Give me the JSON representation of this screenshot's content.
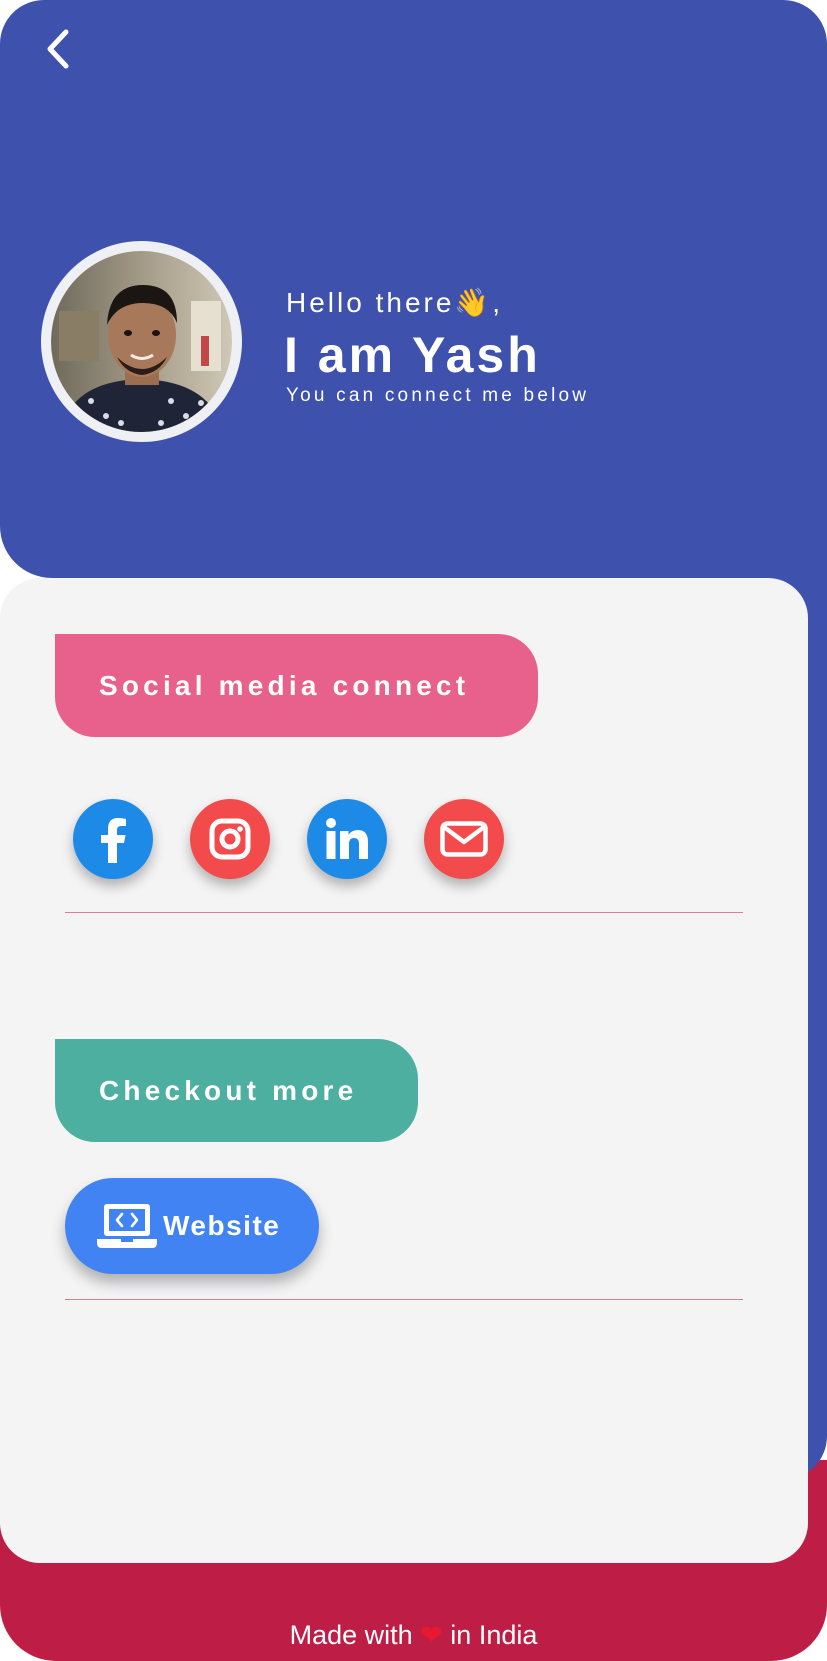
{
  "header": {
    "greeting": "Hello there",
    "greeting_emoji": "👋",
    "greeting_suffix": ",",
    "title": "I am Yash",
    "subtitle": "You can connect me below",
    "back_icon": "chevron-left-icon"
  },
  "social": {
    "heading": "Social media connect",
    "buttons": [
      {
        "name": "facebook",
        "icon": "facebook-icon",
        "color": "#1e8ae8"
      },
      {
        "name": "instagram",
        "icon": "instagram-icon",
        "color": "#f34b4b"
      },
      {
        "name": "linkedin",
        "icon": "linkedin-icon",
        "color": "#1e8ae8"
      },
      {
        "name": "email",
        "icon": "mail-icon",
        "color": "#f34b4b"
      }
    ]
  },
  "more": {
    "heading": "Checkout more",
    "website_label": "Website",
    "website_icon": "laptop-code-icon"
  },
  "footer": {
    "prefix": "Made with ",
    "heart": "❤",
    "suffix": " in India"
  },
  "colors": {
    "header_bg": "#3d51ad",
    "card_bg": "#f4f4f5",
    "social_pill": "#e8608c",
    "more_pill": "#4caf9f",
    "website_button": "#4183f3",
    "footer_bg": "#be1e45"
  }
}
